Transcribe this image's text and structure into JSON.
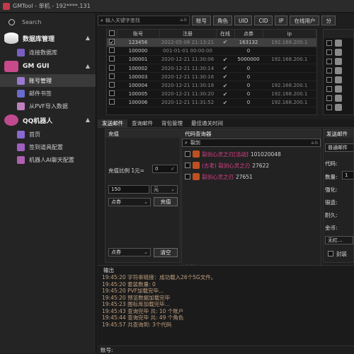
{
  "window": {
    "title": "GMTool - 单机 - 192****.131"
  },
  "sidebar": {
    "search_label": "Search",
    "groups": [
      {
        "label": "数据库管理",
        "items": [
          {
            "label": "连接数据库"
          }
        ]
      },
      {
        "label": "GM GUI",
        "items": [
          {
            "label": "账号管理"
          },
          {
            "label": "邮件书签"
          },
          {
            "label": "从PVF导入数据"
          }
        ]
      },
      {
        "label": "QQ机器人",
        "items": [
          {
            "label": "首页"
          },
          {
            "label": "签到道具配置"
          },
          {
            "label": "机器人AI聊天配置"
          }
        ]
      }
    ]
  },
  "toolbar": {
    "search_placeholder": "输入关键字查找",
    "search_mode": "a-b",
    "buttons": [
      "账号",
      "角色",
      "UID",
      "CID",
      "IP",
      "在线用户",
      "分"
    ]
  },
  "accounts": {
    "columns": [
      "账号",
      "注册",
      "在线",
      "点券",
      "ip"
    ],
    "rows": [
      {
        "account": "123456",
        "reg": "2022-05-06 21:13:21",
        "online": true,
        "points": "163132",
        "ip": "192.168.200.1",
        "selected": true
      },
      {
        "account": "100000",
        "reg": "001-01-01 00:00:00",
        "online": false,
        "points": "0",
        "ip": "",
        "selected": false
      },
      {
        "account": "100001",
        "reg": "2020-12-21 11:30:06",
        "online": true,
        "points": "5000000",
        "ip": "192.168.200.1",
        "selected": false
      },
      {
        "account": "100002",
        "reg": "2020-12-21 11:30:14",
        "online": true,
        "points": "0",
        "ip": "",
        "selected": false
      },
      {
        "account": "100003",
        "reg": "2020-12-21 11:30:16",
        "online": true,
        "points": "0",
        "ip": "",
        "selected": false
      },
      {
        "account": "100004",
        "reg": "2020-12-21 11:30:18",
        "online": true,
        "points": "0",
        "ip": "192.168.200.1",
        "selected": false
      },
      {
        "account": "100005",
        "reg": "2020-12-21 11:30:20",
        "online": true,
        "points": "0",
        "ip": "192.168.200.1",
        "selected": false
      },
      {
        "account": "100006",
        "reg": "2020-12-21 11:31:52",
        "online": true,
        "points": "0",
        "ip": "192.168.200.1",
        "selected": false
      }
    ]
  },
  "tabs": [
    "发送邮件",
    "查询邮件",
    "背包管理",
    "最佳通关时间"
  ],
  "recharge": {
    "title": "充值",
    "ratio_label": "充值比例 1元=",
    "ratio_value": "0",
    "amount": "150",
    "unit": "元",
    "currency1": "点券",
    "recharge_btn": "充值",
    "currency2": "点券",
    "clear_btn": "清空"
  },
  "code_query": {
    "title": "代码查询器",
    "search_value": "裂剑",
    "results": [
      {
        "name": "裂剑心灵之刃[活动]",
        "code": "101020048"
      },
      {
        "name": "(古老) 裂剑心灵之刃",
        "code": "27622"
      },
      {
        "name": "裂剑心灵之刃",
        "code": "27651"
      }
    ],
    "footer": "书签"
  },
  "send_mail": {
    "title": "发送邮件",
    "type": "普通邮件",
    "fields": [
      "代码:",
      "数量:",
      "强化:",
      "锻造:",
      "耐久:",
      "金币:"
    ],
    "values": [
      "",
      "1",
      "",
      "",
      "",
      ""
    ],
    "select": "无红...",
    "seal": "封装"
  },
  "output": {
    "title": "输出",
    "log": [
      "19:45:20 字符串链接：成功载入26个5G文件。",
      "19:45:20 套装数量: 0",
      "19:45:20 PVF加载完毕...",
      "19:45:20 预览数据加载完毕",
      "19:45:23 图标库加载完毕...",
      "19:45:43 查询完毕 共: 10 个账户",
      "19:45:44 查询完毕 共: 49 个角色",
      "19:45:57 共查询到: 3个代码"
    ]
  },
  "status": {
    "label": "账号:"
  },
  "colors": {
    "accent": "#e0408a",
    "log": "#c0a080"
  }
}
